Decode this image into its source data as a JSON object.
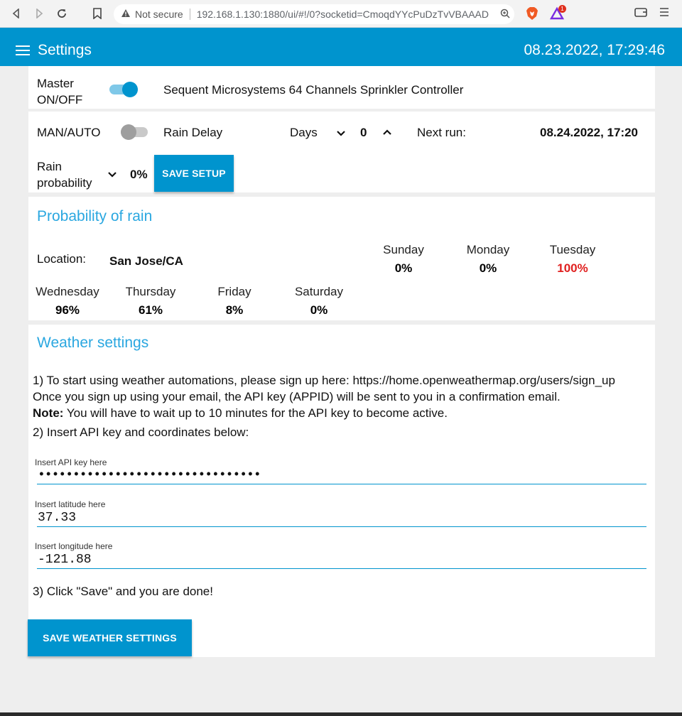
{
  "browser": {
    "security_label": "Not secure",
    "url": "192.168.1.130:1880/ui/#!/0?socketid=CmoqdYYcPuDzTvVBAAAD",
    "notification_count": "1"
  },
  "header": {
    "title": "Settings",
    "datetime": "08.23.2022, 17:29:46"
  },
  "master": {
    "label_line1": "Master",
    "label_line2": "ON/OFF",
    "enabled": true,
    "controller_name": "Sequent Microsystems 64 Channels Sprinkler Controller"
  },
  "controls": {
    "man_auto_label": "MAN/AUTO",
    "man_auto_enabled": false,
    "rain_delay_label": "Rain Delay",
    "days_label": "Days",
    "days_value": "0",
    "next_run_label": "Next run:",
    "next_run_value": "08.24.2022, 17:20",
    "rain_prob_label_line1": "Rain",
    "rain_prob_label_line2": "probability",
    "rain_prob_value": "0%",
    "save_setup_label": "SAVE SETUP"
  },
  "probability": {
    "title": "Probability of rain",
    "location_label": "Location:",
    "location_value": "San Jose/CA",
    "days": [
      {
        "name": "Sunday",
        "value": "0%",
        "color": "#000000"
      },
      {
        "name": "Monday",
        "value": "0%",
        "color": "#000000"
      },
      {
        "name": "Tuesday",
        "value": "100%",
        "color": "#e0201f"
      },
      {
        "name": "Wednesday",
        "value": "96%",
        "color": "#000000"
      },
      {
        "name": "Thursday",
        "value": "61%",
        "color": "#000000"
      },
      {
        "name": "Friday",
        "value": "8%",
        "color": "#000000"
      },
      {
        "name": "Saturday",
        "value": "0%",
        "color": "#000000"
      }
    ]
  },
  "weather": {
    "title": "Weather settings",
    "step1": "1) To start using weather automations, please sign up here: https://home.openweathermap.org/users/sign_up",
    "step1b": "Once you sign up using your email, the API key (APPID) will be sent to you in a confirmation email.",
    "note_label": "Note:",
    "note_text": " You will have to wait up to 10 minutes for the API key to become active.",
    "step2": "2) Insert API key and coordinates below:",
    "api_label": "Insert API key here",
    "api_value": "••••••••••••••••••••••••••••••••",
    "lat_label": "Insert latitude here",
    "lat_value": "37.33",
    "lon_label": "Insert longitude here",
    "lon_value": "-121.88",
    "step3": "3) Click \"Save\" and you are done!",
    "save_label": "SAVE WEATHER SETTINGS"
  },
  "colors": {
    "accent": "#0094ce",
    "title_blue": "#2aa7e0",
    "alert_red": "#e0201f"
  }
}
